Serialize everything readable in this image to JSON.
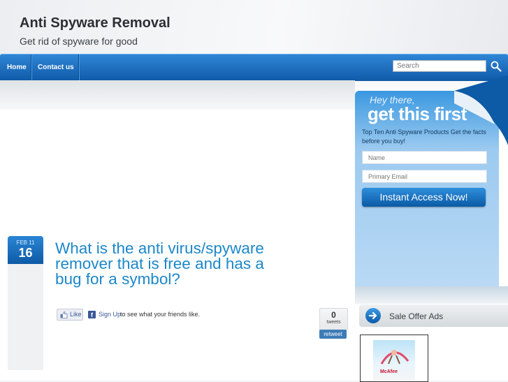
{
  "site": {
    "title": "Anti Spyware Removal",
    "tagline": "Get rid of spyware for good"
  },
  "nav": {
    "items": [
      "Home",
      "Contact us"
    ],
    "search_placeholder": "Search",
    "accent": "#1669bb"
  },
  "post": {
    "month_day": "FEB 11",
    "day": "16",
    "title": "What is the anti virus/spyware remover that is free and has a bug for a symbol?",
    "like_label": "Like",
    "signup_label": "Sign Up",
    "friends_text": "to see what your friends like.",
    "tweet_count": "0",
    "tweet_label": "tweets",
    "retweet_label": "retweet"
  },
  "optin": {
    "hey": "Hey there,",
    "headline": "get this first",
    "description": "Top Ten Anti Spyware Products Get the facts before you buy!",
    "name_placeholder": "Name",
    "email_placeholder": "Primary Email",
    "button": "Instant Access Now!"
  },
  "sidebar": {
    "sale_title": "Sale Offer Ads",
    "ad_brand": "McAfee"
  }
}
